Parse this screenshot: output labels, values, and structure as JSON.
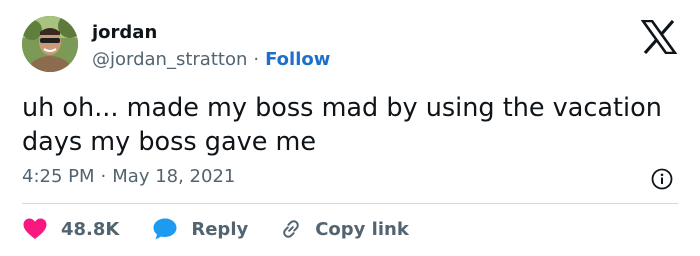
{
  "author": {
    "name": "jordan",
    "handle": "@jordan_stratton",
    "separator": "·",
    "follow_label": "Follow"
  },
  "tweet": {
    "text": "uh oh... made my boss mad by using the vacation days my boss gave me",
    "time": "4:25 PM",
    "separator": "·",
    "date": "May 18, 2021"
  },
  "actions": {
    "likes": "48.8K",
    "reply_label": "Reply",
    "copy_link_label": "Copy link"
  },
  "icons": {
    "brand": "x-logo-icon",
    "info": "info-icon",
    "like": "heart-icon",
    "reply": "speech-bubble-icon",
    "copy": "link-icon"
  },
  "colors": {
    "text": "#0f1419",
    "secondary": "#536471",
    "follow": "#1d70c9",
    "like": "#f91880",
    "reply": "#1d9bf0",
    "divider": "#cfd9de"
  }
}
